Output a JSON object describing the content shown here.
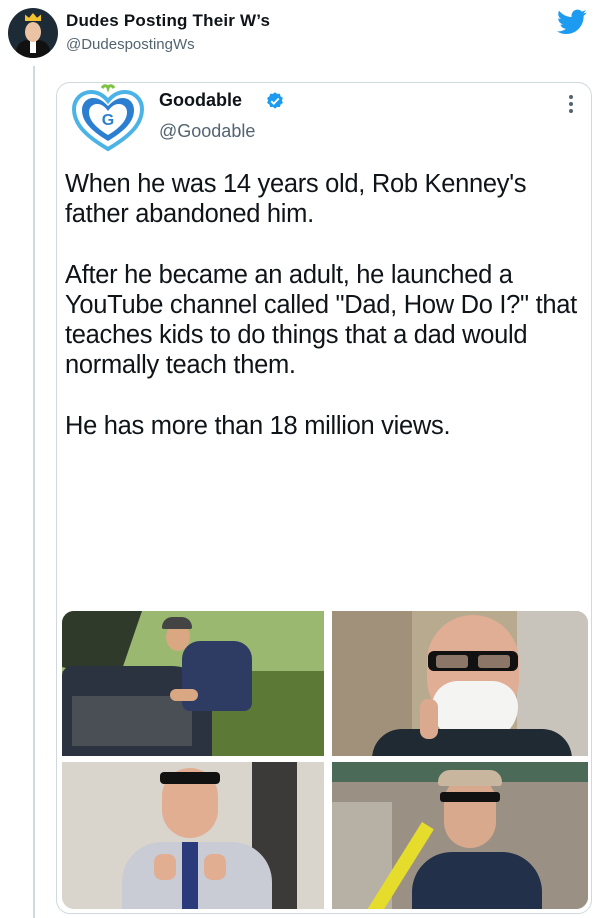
{
  "outer_tweet": {
    "author_name": "Dudes Posting Their W’s",
    "author_handle": "@DudespostingWs",
    "logo_icon": "twitter-bird-icon"
  },
  "quoted_tweet": {
    "author_name": "Goodable",
    "author_handle": "@Goodable",
    "avatar_letter": "G",
    "verified": true,
    "paragraphs": [
      "When he was 14 years old, Rob Kenney's father abandoned him.",
      "After he became an adult, he launched a YouTube channel called \"Dad, How Do I?\" that teaches kids to do things that a dad would normally teach them.",
      "He has more than 18 million views."
    ],
    "photos": [
      {
        "description_icon": "man-fixing-car-photo"
      },
      {
        "description_icon": "man-shaving-photo"
      },
      {
        "description_icon": "man-tying-tie-photo"
      },
      {
        "description_icon": "man-with-level-tool-photo"
      }
    ]
  },
  "colors": {
    "twitter_blue": "#1d9bf0",
    "text": "#0f1419",
    "secondary_text": "#536471",
    "border": "#cfd9de"
  }
}
